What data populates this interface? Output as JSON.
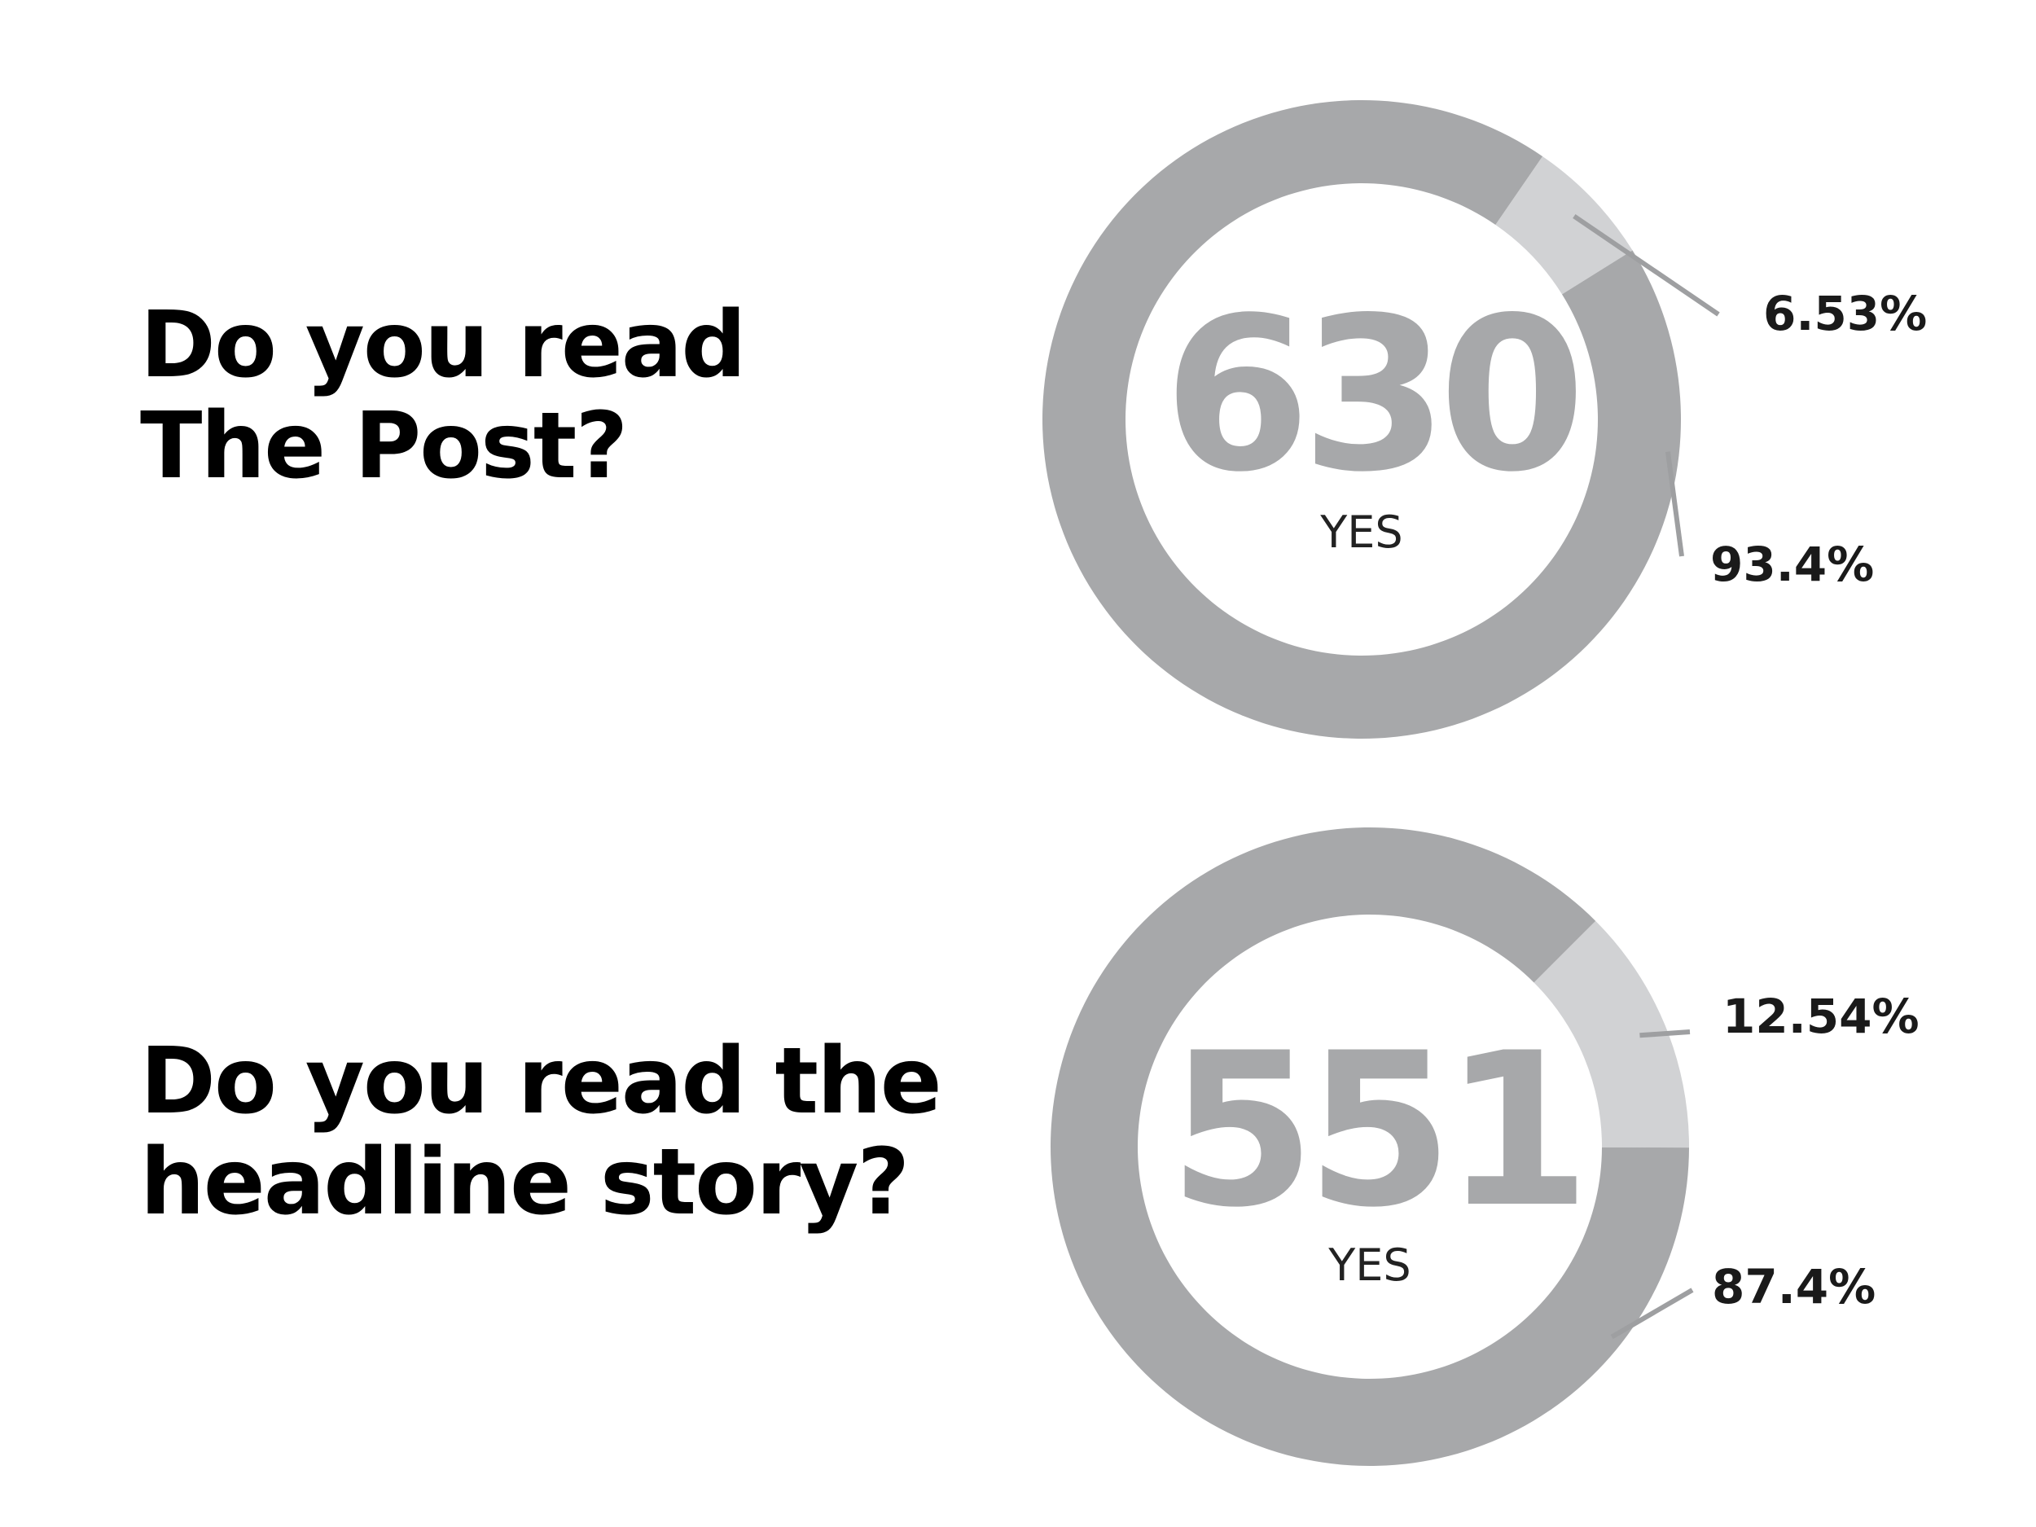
{
  "charts": [
    {
      "question_lines": [
        "Do you read",
        "The Post?"
      ],
      "center_number": "630",
      "center_label": "YES"
    },
    {
      "question_lines": [
        "Do you read the",
        "headline story?"
      ],
      "center_number": "551",
      "center_label": "YES"
    }
  ],
  "colors": {
    "background": "#ffffff",
    "major_slice": "#a7a8aa",
    "minor_slice": "#d1d2d4",
    "number": "#a7a8aa",
    "text": "#000000",
    "leader_line": "#9e9fa1"
  },
  "chart_data": [
    {
      "type": "pie",
      "title": "Do you read The Post?",
      "slices": [
        {
          "label": "6.53%",
          "value": 6.53
        },
        {
          "label": "93.4%",
          "value": 93.4
        }
      ],
      "center_text": "630",
      "center_subtext": "YES"
    },
    {
      "type": "pie",
      "title": "Do you read the headline story?",
      "slices": [
        {
          "label": "12.54%",
          "value": 12.54
        },
        {
          "label": "87.4%",
          "value": 87.4
        }
      ],
      "center_text": "551",
      "center_subtext": "YES"
    }
  ]
}
